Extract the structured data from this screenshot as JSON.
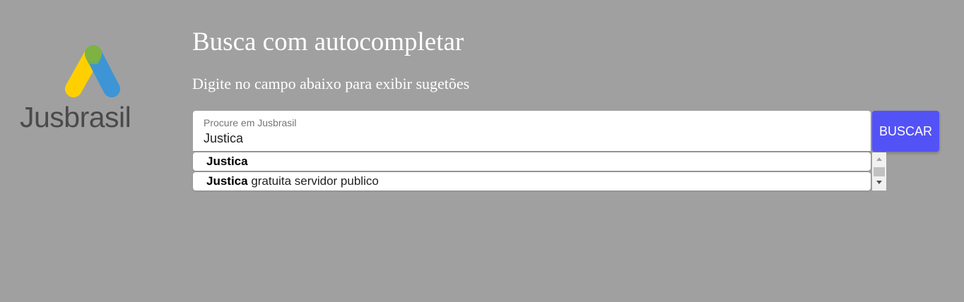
{
  "logo": {
    "text": "Jusbrasil",
    "colors": {
      "yellow": "#ffcf00",
      "green": "#7cb342",
      "blue": "#3d95d6",
      "text": "#4a4a4a"
    }
  },
  "header": {
    "title": "Busca com autocompletar",
    "subtitle": "Digite no campo abaixo para exibir sugetões"
  },
  "search": {
    "label": "Procure em Jusbrasil",
    "value": "Justica",
    "button_label": "BUSCAR"
  },
  "suggestions": [
    {
      "match": "Justica",
      "rest": ""
    },
    {
      "match": "Justica",
      "rest": " gratuita servidor publico"
    }
  ],
  "colors": {
    "background": "#a0a0a0",
    "accent": "#5352f6"
  },
  "icons": {
    "scroll_up": "scroll-up-arrow-icon",
    "scroll_down": "scroll-down-arrow-icon"
  }
}
